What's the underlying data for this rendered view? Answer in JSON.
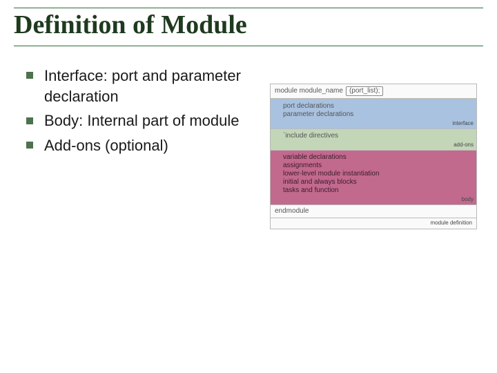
{
  "title": "Definition of Module",
  "bullets": [
    "Interface: port and parameter declaration",
    "Body: Internal part of module",
    "Add-ons (optional)"
  ],
  "diagram": {
    "header_prefix": "module module_name",
    "header_port": "(port_list);",
    "interface": {
      "lines": [
        "port declarations",
        "parameter declarations"
      ],
      "tag": "interface"
    },
    "addons": {
      "lines": [
        "`include directives"
      ],
      "tag": "add-ons"
    },
    "body": {
      "lines": [
        "variable declarations",
        "assignments",
        "lower-level module instantiation",
        "initial and always blocks",
        "tasks and function"
      ],
      "tag": "body"
    },
    "footer": "endmodule",
    "outer_tag": "module definition"
  }
}
